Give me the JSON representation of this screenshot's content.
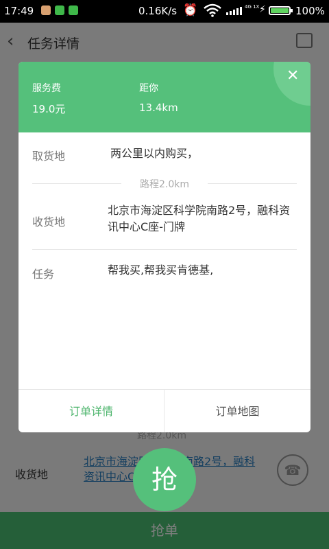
{
  "status_bar": {
    "time": "17:49",
    "speed": "0.16K/s",
    "network": "4G 1X",
    "battery_pct": "100%",
    "battery_level": 1.0
  },
  "header": {
    "title": "任务详情"
  },
  "background": {
    "route": "路程2.0km",
    "deliver_label": "收货地",
    "deliver_address": "北京市海淀区科学院南路2号，融科资讯中心C座-门牌",
    "grab_button": "抢单"
  },
  "grab_circle": "抢",
  "dialog": {
    "fee_label": "服务费",
    "fee_value": "19.0元",
    "distance_label": "距你",
    "distance_value": "13.4km",
    "pickup_label": "取货地",
    "pickup_value": "两公里以内购买，",
    "route": "路程2.0km",
    "deliver_label": "收货地",
    "deliver_value": "北京市海淀区科学院南路2号，融科资讯中心C座-门牌",
    "task_label": "任务",
    "task_value": "帮我买,帮我买肯德基,",
    "order_detail": "订单详情",
    "order_map": "订单地图"
  },
  "colors": {
    "accent": "#55c07b",
    "link": "#2a7fc0"
  }
}
